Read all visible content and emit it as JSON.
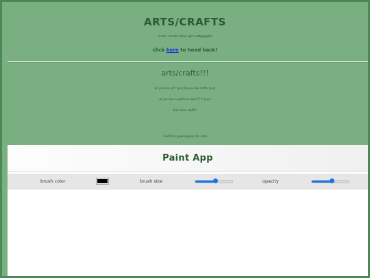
{
  "header": {
    "title": "ARTS/CRAFTS",
    "construction": "under construction get outtgggghh",
    "back_prefix": "click ",
    "back_link": "here",
    "back_suffix": " to head back!"
  },
  "intro": {
    "title": "arts/crafts!!!",
    "line1": "do you like art? (yes) do you like crafts (yes)",
    "line2": "do you like angelfood cake????? (yes)",
    "line3": "then draw stuff!!!",
    "credits": "credits to geeks4geeks for code"
  },
  "paint_app": {
    "title": "Paint App",
    "brush_color_label": "brush color",
    "brush_color": "#000000",
    "brush_size_label": "brush size",
    "brush_size_level": 0.55,
    "opacity_label": "opacity",
    "opacity_level": 0.55
  }
}
